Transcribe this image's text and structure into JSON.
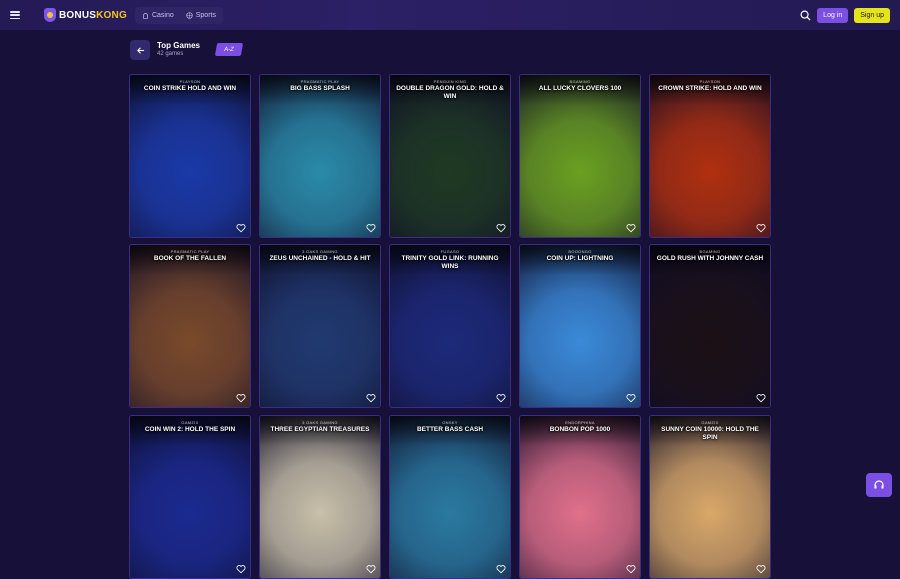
{
  "header": {
    "logo_a": "BONUS",
    "logo_b": "KONG",
    "nav": [
      {
        "label": "Casino",
        "icon": "casino-icon"
      },
      {
        "label": "Sports",
        "icon": "sports-icon"
      }
    ],
    "login_label": "Log in",
    "signup_label": "Sign up"
  },
  "section": {
    "title": "Top Games",
    "count": "42 games",
    "sort_label": "A-Z"
  },
  "games": [
    {
      "provider": "PLAYSON",
      "title": "COIN STRIKE HOLD AND WIN",
      "bg": "#1a3aa8"
    },
    {
      "provider": "PRAGMATIC PLAY",
      "title": "BIG BASS SPLASH",
      "bg": "#2a8aa8"
    },
    {
      "provider": "PENGUIN KING",
      "title": "DOUBLE DRAGON GOLD: HOLD & WIN",
      "bg": "#1e3a22"
    },
    {
      "provider": "BGAMING",
      "title": "ALL LUCKY CLOVERS 100",
      "bg": "#6aa020"
    },
    {
      "provider": "PLAYSON",
      "title": "CROWN STRIKE: HOLD AND WIN",
      "bg": "#b0300e"
    },
    {
      "provider": "PRAGMATIC PLAY",
      "title": "BOOK OF THE FALLEN",
      "bg": "#7a4a2a"
    },
    {
      "provider": "3 OAKS GAMING",
      "title": "ZEUS UNCHAINED - HOLD & HIT",
      "bg": "#203a70"
    },
    {
      "provider": "FUGASO",
      "title": "TRINITY GOLD LINK: RUNNING WINS",
      "bg": "#1c2a7a"
    },
    {
      "provider": "BOOONGO",
      "title": "COIN UP: LIGHTNING",
      "bg": "#3a8ad8"
    },
    {
      "provider": "BGAMING",
      "title": "GOLD RUSH WITH JOHNNY CASH",
      "bg": "#1a1014"
    },
    {
      "provider": "GAMZIX",
      "title": "COIN WIN 2: HOLD THE SPIN",
      "bg": "#1a2a90"
    },
    {
      "provider": "3 OAKS GAMING",
      "title": "THREE EGYPTIAN TREASURES",
      "bg": "#c8c0a8"
    },
    {
      "provider": "ONSKY",
      "title": "BETTER BASS CASH",
      "bg": "#2a7aa0"
    },
    {
      "provider": "ENDORPHINA",
      "title": "BONBON POP 1000",
      "bg": "#e0708a"
    },
    {
      "provider": "GAMZIX",
      "title": "SUNNY COIN 10000: HOLD THE SPIN",
      "bg": "#d8a868"
    }
  ]
}
